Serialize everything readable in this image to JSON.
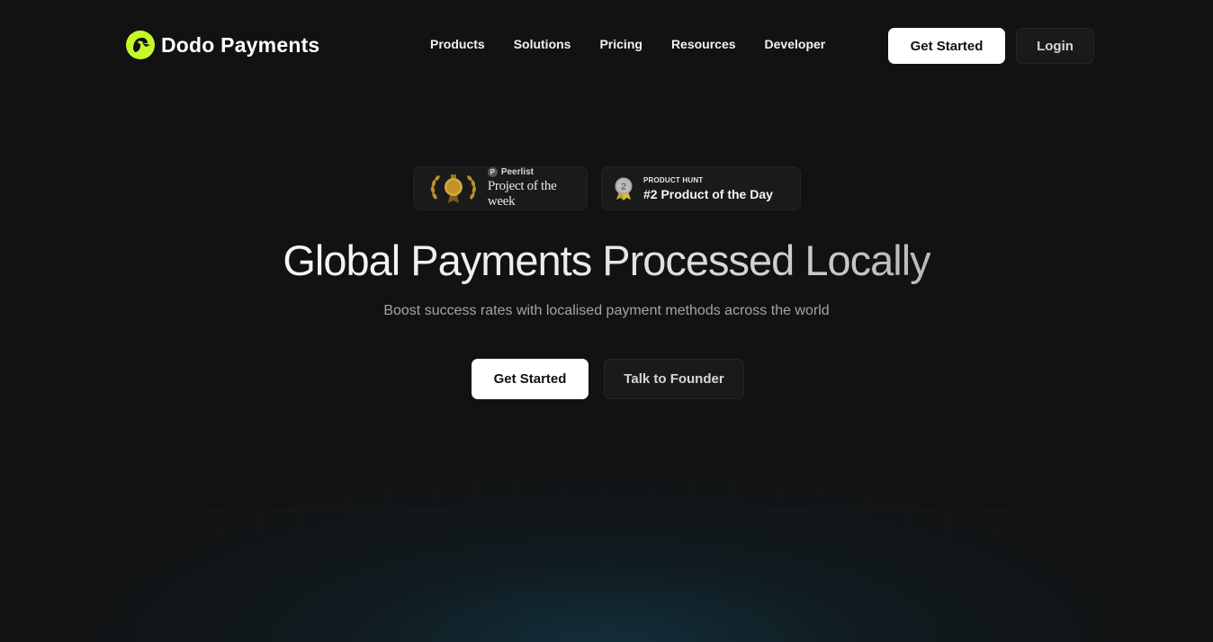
{
  "brand": {
    "name": "Dodo Payments",
    "accent": "#c5f82a"
  },
  "nav": {
    "items": [
      {
        "label": "Products"
      },
      {
        "label": "Solutions"
      },
      {
        "label": "Pricing"
      },
      {
        "label": "Resources"
      },
      {
        "label": "Developer"
      }
    ],
    "get_started": "Get Started",
    "login": "Login"
  },
  "badges": {
    "peerlist": {
      "rank": "#1",
      "brand": "Peerlist",
      "title": "Project of the week"
    },
    "product_hunt": {
      "rank": "2",
      "label": "PRODUCT HUNT",
      "title": "#2 Product of the Day"
    }
  },
  "hero": {
    "title": "Global Payments Processed Locally",
    "subtitle": "Boost success rates with localised payment methods across the world",
    "primary_cta": "Get Started",
    "secondary_cta": "Talk to Founder"
  }
}
